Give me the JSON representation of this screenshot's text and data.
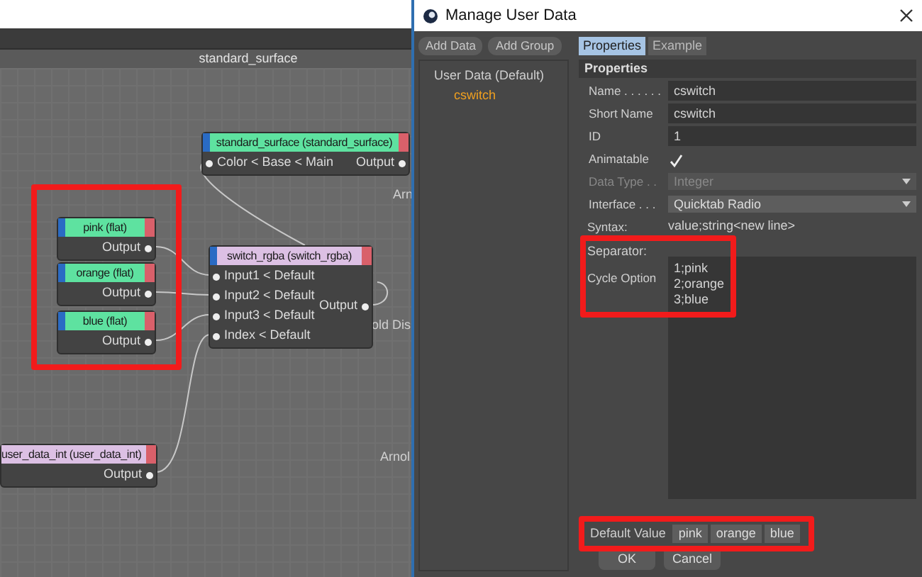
{
  "editor": {
    "title": "standard_surface",
    "highlight_frame": true,
    "nodes": [
      {
        "title": "standard_surface (standard_surface)",
        "color": "#5ee2a0",
        "inputs": [
          "Color < Base < Main"
        ],
        "output": "Output"
      },
      {
        "title": "pink (flat)",
        "color": "#5ee2a0",
        "output": "Output"
      },
      {
        "title": "orange (flat)",
        "color": "#5ee2a0",
        "output": "Output"
      },
      {
        "title": "blue (flat)",
        "color": "#5ee2a0",
        "output": "Output"
      },
      {
        "title": "switch_rgba (switch_rgba)",
        "color": "#dcc0e4",
        "inputs": [
          "Input1 < Default",
          "Input2 < Default",
          "Input3 < Default",
          "Index < Default"
        ],
        "output": "Output"
      },
      {
        "title": "user_data_int (user_data_int)",
        "color": "#dcc0e4",
        "output": "Output"
      }
    ],
    "labels": [
      "Arn",
      "old Dis",
      "Arnol"
    ]
  },
  "dialog": {
    "title": "Manage User Data",
    "buttons": [
      "Add Data",
      "Add Group"
    ],
    "tree": [
      {
        "label": "User Data (Default)",
        "selected": false,
        "children": [
          {
            "label": "cswitch",
            "selected": true
          }
        ]
      }
    ],
    "tabs": [
      {
        "label": "Properties",
        "selected": true
      },
      {
        "label": "Example",
        "selected": false
      }
    ],
    "section": "Properties",
    "fields": [
      {
        "kind": "text",
        "label": "Name . . . . . .",
        "value": "cswitch"
      },
      {
        "kind": "text",
        "label": "Short Name",
        "value": "cswitch"
      },
      {
        "kind": "text",
        "label": "ID",
        "value": "1"
      },
      {
        "kind": "checkbox",
        "label": "Animatable",
        "checked": true
      },
      {
        "kind": "select",
        "label": "Data Type . .",
        "value": "Integer",
        "disabled": true
      },
      {
        "kind": "select",
        "label": "Interface . . .",
        "value": "Quicktab Radio",
        "disabled": false
      },
      {
        "kind": "info",
        "label": "Syntax:",
        "value": "value;string<new line>"
      }
    ],
    "cycle": {
      "highlighted": true,
      "separator": "Separator:",
      "label": "Cycle Option",
      "lines": [
        "1;pink",
        "2;orange",
        "3;blue"
      ]
    },
    "default_value": {
      "highlighted": true,
      "label": "Default Value",
      "options": [
        {
          "label": "pink",
          "selected": false
        },
        {
          "label": "orange",
          "selected": false
        },
        {
          "label": "blue",
          "selected": false
        }
      ]
    },
    "footer_buttons": [
      "OK",
      "Cancel"
    ]
  }
}
